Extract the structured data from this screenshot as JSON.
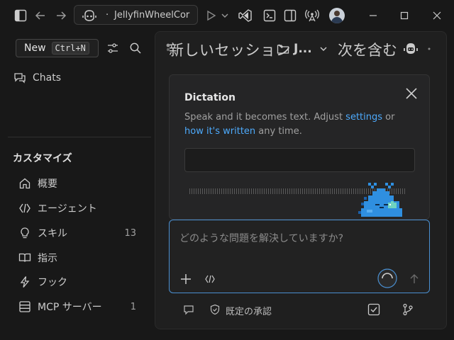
{
  "titlebar": {
    "title": "JellyfinWheelCor",
    "separator": "·",
    "icons": [
      "sidebar-toggle-icon",
      "arrow-left-icon",
      "arrow-right-icon",
      "copilot-icon",
      "play-icon",
      "chevron-down-icon",
      "vscode-icon",
      "terminal-icon",
      "split-panel-icon",
      "broadcast-icon",
      "minimize-icon",
      "maximize-icon",
      "close-icon"
    ]
  },
  "tooltip": {
    "label": "New",
    "shortcut": "Ctrl+N"
  },
  "sidebar": {
    "chats_label": "Chats",
    "section_title": "カスタマイズ",
    "items": [
      {
        "label": "概要",
        "icon": "home-icon",
        "count": ""
      },
      {
        "label": "エージェント",
        "icon": "agent-icon",
        "count": ""
      },
      {
        "label": "スキル",
        "icon": "lightbulb-icon",
        "count": "13"
      },
      {
        "label": "指示",
        "icon": "book-icon",
        "count": ""
      },
      {
        "label": "フック",
        "icon": "lightning-icon",
        "count": ""
      },
      {
        "label": "MCP サーバー",
        "icon": "server-icon",
        "count": "1"
      }
    ]
  },
  "session": {
    "title": "新しいセッション",
    "folder": "J...",
    "contains": "次を含む"
  },
  "dictation": {
    "title": "Dictation",
    "body_prefix": "Speak and it becomes text. Adjust ",
    "settings_link": "settings",
    "body_mid": " or",
    "how_link": "how it's written",
    "body_suffix": " any time."
  },
  "chat": {
    "placeholder": "どのような問題を解決していますか?"
  },
  "footer": {
    "approval_label": "既定の承認"
  },
  "colors": {
    "accent": "#4daafc",
    "focus_border": "#4a8fd0",
    "mascot": "#2f8fe0"
  }
}
